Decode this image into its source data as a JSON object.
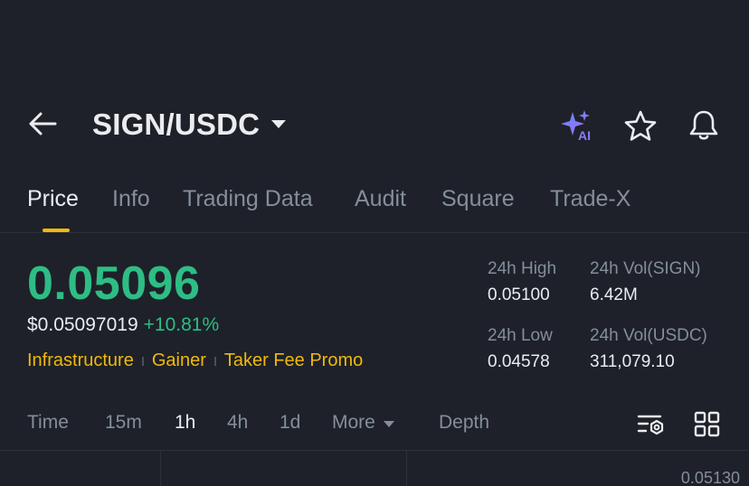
{
  "header": {
    "pair": "SIGN/USDC",
    "icons": [
      "back-arrow-icon",
      "caret-down-icon",
      "ai-sparkle-icon",
      "star-icon",
      "bell-icon"
    ]
  },
  "tabs": [
    {
      "label": "Price",
      "active": true
    },
    {
      "label": "Info",
      "active": false
    },
    {
      "label": "Trading Data",
      "active": false
    },
    {
      "label": "Audit",
      "active": false
    },
    {
      "label": "Square",
      "active": false
    },
    {
      "label": "Trade-X",
      "active": false
    }
  ],
  "ticker": {
    "last_price": "0.05096",
    "usd_price": "$0.05097019",
    "change_pct": "+10.81%",
    "tags": [
      "Infrastructure",
      "Gainer",
      "Taker Fee Promo"
    ]
  },
  "stats": {
    "high_label": "24h High",
    "high_value": "0.05100",
    "vol_base_label": "24h Vol(SIGN)",
    "vol_base_value": "6.42M",
    "low_label": "24h Low",
    "low_value": "0.04578",
    "vol_quote_label": "24h Vol(USDC)",
    "vol_quote_value": "311,079.10"
  },
  "intervals": {
    "time": "Time",
    "m15": "15m",
    "h1": "1h",
    "h4": "4h",
    "d1": "1d",
    "more": "More",
    "depth": "Depth",
    "selected": "1h"
  },
  "chart": {
    "top_price_label": "0.05130"
  },
  "colors": {
    "background": "#1e2129",
    "up_green": "#2ebd85",
    "accent_yellow": "#f0b90b",
    "muted": "#848e9c",
    "ai_purple": "#7b6cf6"
  }
}
